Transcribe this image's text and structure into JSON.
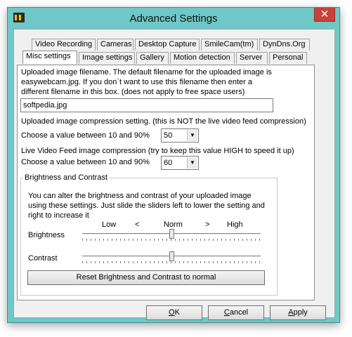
{
  "window": {
    "title": "Advanced Settings",
    "close_glyph": "✕",
    "app_icon": "webcam-clapper-icon"
  },
  "tabs_row1": [
    "Video Recording",
    "Cameras",
    "Desktop Capture",
    "SmileCam(tm)",
    "DynDns.Org"
  ],
  "tabs_row2": [
    "Misc settings",
    "Image settings",
    "Gallery",
    "Motion detection",
    "Server",
    "Personal"
  ],
  "active_tab": "Misc settings",
  "filename_section": {
    "desc_line1": "Uploaded image filename. The default filename for the uploaded image is",
    "desc_line2": "easywebcam.jpg. If you don`t want to use this filename then enter a",
    "desc_line3": "different filename in this box. (does not apply to free space users)",
    "value": "softpedia.jpg"
  },
  "compression": {
    "label": "Uploaded image compression setting. (this is NOT the live video feed compression)",
    "choose_label": "Choose a value between 10 and 90%",
    "value": "50"
  },
  "live_compression": {
    "label": "Live Video Feed image compression (try to keep this value HIGH to speed it up)",
    "choose_label": "Choose a value between 10 and 90%",
    "value": "60"
  },
  "brightness_contrast": {
    "group_title": "Brightness and Contrast",
    "desc_line1": "You can alter the brightness and contrast of your uploaded image",
    "desc_line2": "using these settings. Just slide the sliders left to lower the setting and",
    "desc_line3": "right to increase it",
    "scale_low": "Low",
    "scale_lt": "<",
    "scale_norm": "Norm",
    "scale_gt": ">",
    "scale_high": "High",
    "brightness_label": "Brightness",
    "contrast_label": "Contrast",
    "brightness_level": 0.5,
    "contrast_level": 0.5,
    "reset_label": "Reset Brightness and Contrast to normal"
  },
  "buttons": {
    "ok_mnemonic": "O",
    "ok_rest": "K",
    "cancel_mnemonic": "C",
    "cancel_rest": "ancel",
    "apply_mnemonic": "A",
    "apply_rest": "pply"
  }
}
